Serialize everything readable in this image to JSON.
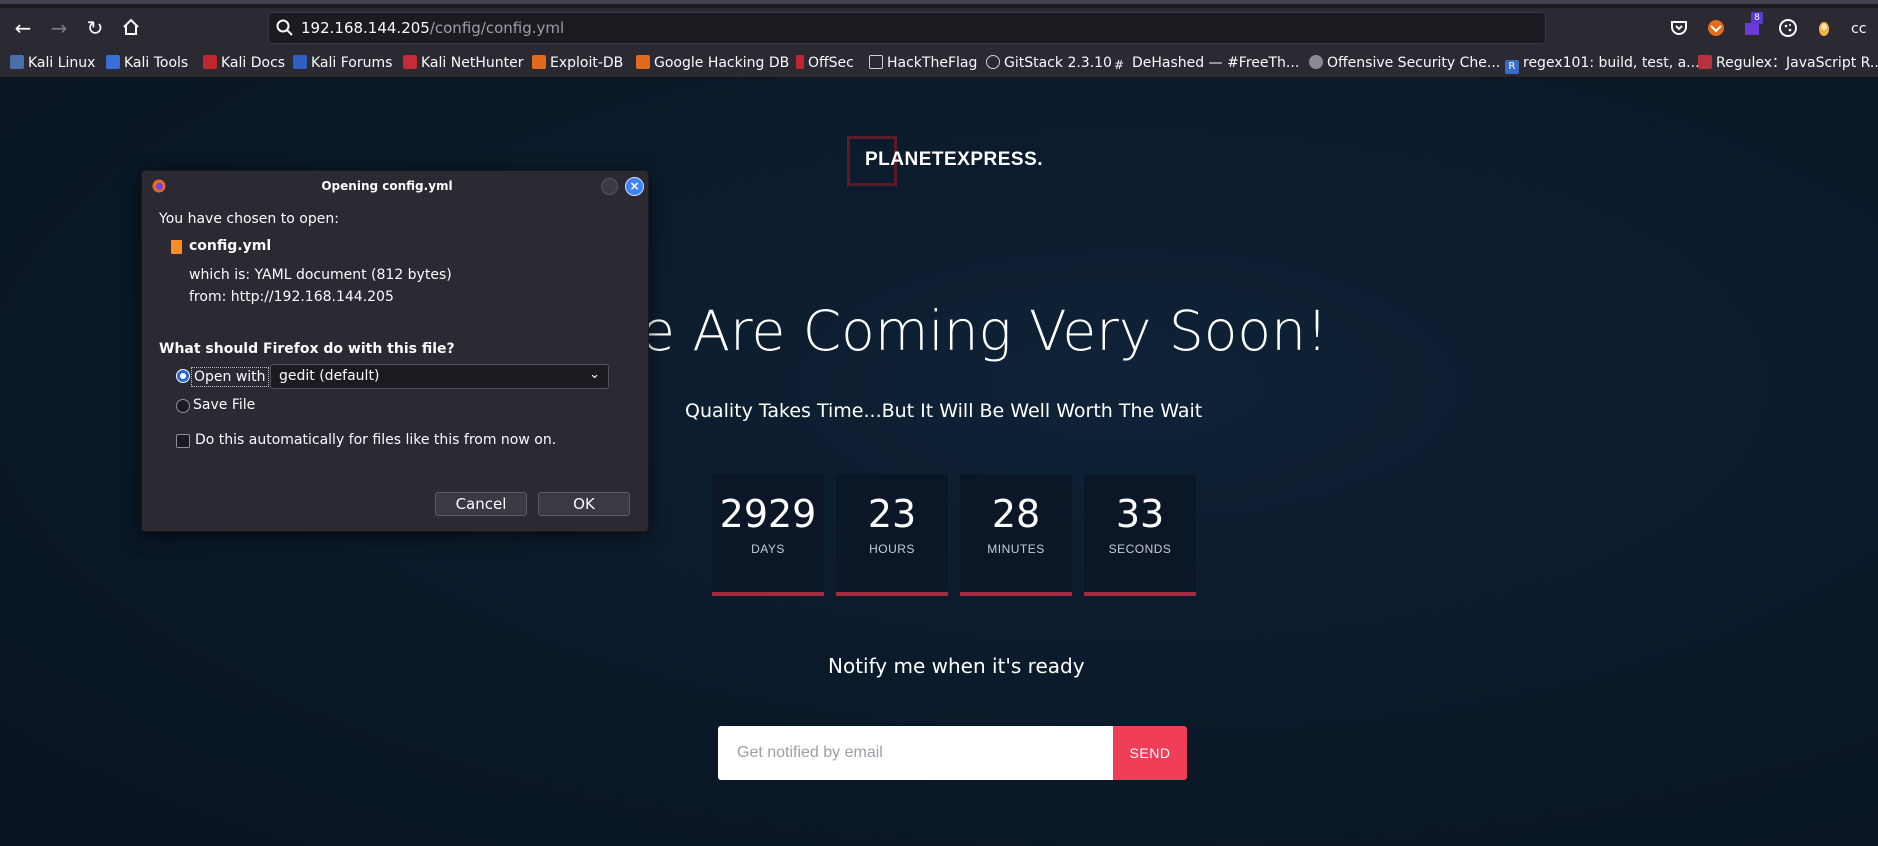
{
  "browser": {
    "url_host": "192.168.144.205",
    "url_path": "/config/config.yml",
    "extension_badge": "8",
    "bookmarks": [
      "Kali Linux",
      "Kali Tools",
      "Kali Docs",
      "Kali Forums",
      "Kali NetHunter",
      "Exploit-DB",
      "Google Hacking DB",
      "OffSec",
      "HackTheFlag",
      "GitStack 2.3.10",
      "DeHashed — #FreeTh...",
      "Offensive Security Che...",
      "regex101: build, test, a...",
      "Regulex：JavaScript R..."
    ]
  },
  "site": {
    "logo": "PLANETEXPRESS.",
    "headline": "e Are Coming Very Soon!",
    "subline": "Quality Takes Time...But It Will Be Well Worth The Wait",
    "countdown": [
      {
        "value": "2929",
        "label": "DAYS"
      },
      {
        "value": "23",
        "label": "HOURS"
      },
      {
        "value": "28",
        "label": "MINUTES"
      },
      {
        "value": "33",
        "label": "SECONDS"
      }
    ],
    "notify_text": "Notify me when it's ready",
    "email_placeholder": "Get notified by email",
    "send_label": "SEND",
    "accent": "#f03e59"
  },
  "dialog": {
    "title": "Opening config.yml",
    "intro": "You have chosen to open:",
    "filename": "config.yml",
    "which_is": "which is:  YAML document (812 bytes)",
    "from": "from:  http://192.168.144.205",
    "question": "What should Firefox do with this file?",
    "open_with_label": "Open with",
    "open_with_app": "gedit (default)",
    "save_file_label": "Save File",
    "auto_label": "Do this automatically for files like this from now on.",
    "cancel_label": "Cancel",
    "ok_label": "OK"
  }
}
